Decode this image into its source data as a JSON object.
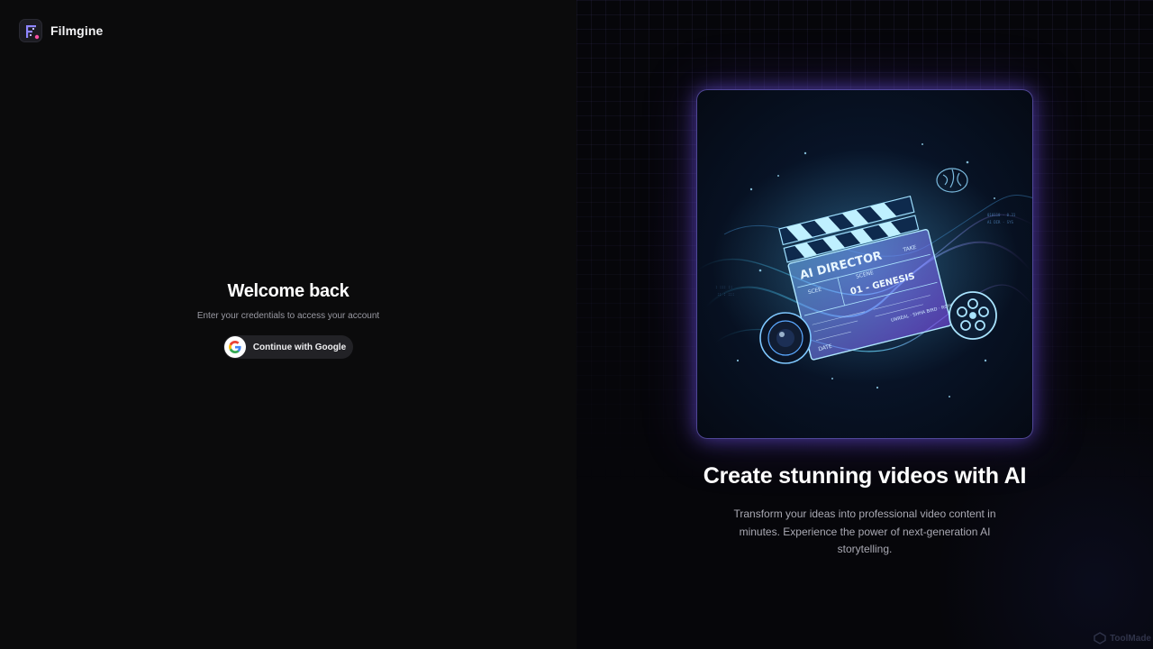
{
  "brand": {
    "name": "Filmgine",
    "logo_icon": "filmgine-logo-icon"
  },
  "login": {
    "title": "Welcome back",
    "subtitle": "Enter your credentials to access your account",
    "google_button_label": "Continue with Google",
    "google_icon": "google-g-icon"
  },
  "hero": {
    "image_icon": "ai-director-clapperboard-illustration",
    "headline": "Create stunning videos with AI",
    "description": "Transform your ideas into professional video content in minutes. Experience the power of next-generation AI storytelling."
  },
  "watermark": {
    "label": "ToolMade"
  },
  "colors": {
    "left_background": "#0b0b0c",
    "right_background": "#06060a",
    "accent_glow": "#7b5cff",
    "google_button_bg": "#222226"
  }
}
